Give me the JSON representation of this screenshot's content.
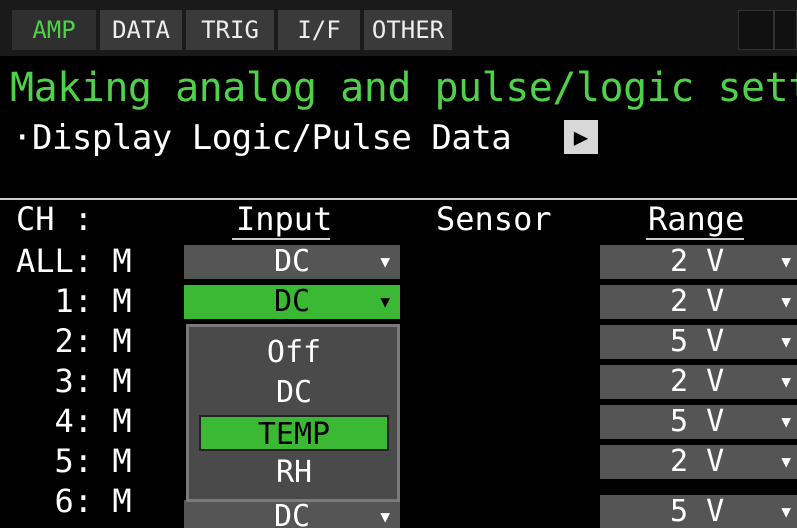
{
  "tabs": [
    {
      "label": "AMP",
      "active": true
    },
    {
      "label": "DATA",
      "active": false
    },
    {
      "label": "TRIG",
      "active": false
    },
    {
      "label": "I/F",
      "active": false
    },
    {
      "label": "OTHER",
      "active": false
    }
  ],
  "title": "Making analog and pulse/logic settings",
  "subtitle": "·Display Logic/Pulse Data",
  "play_icon": "play-icon",
  "headers": {
    "ch": "CH :",
    "input": "Input",
    "sensor": "Sensor",
    "range": "Range"
  },
  "rows": [
    {
      "ch": "ALL: M",
      "input": "DC",
      "range": "2 V"
    },
    {
      "ch": "  1: M",
      "input": "DC",
      "range": "2 V",
      "selected": true
    },
    {
      "ch": "  2: M",
      "range": "5 V"
    },
    {
      "ch": "  3: M",
      "range": "2 V"
    },
    {
      "ch": "  4: M",
      "range": "5 V"
    },
    {
      "ch": "  5: M",
      "range": "2 V"
    },
    {
      "ch": "  6: M",
      "input": "DC",
      "range": "5 V"
    }
  ],
  "dropdown": {
    "options": [
      "Off",
      "DC",
      "TEMP",
      "RH"
    ],
    "selected": "TEMP"
  },
  "colors": {
    "accent_green": "#3cb934",
    "title_green": "#4fd24a",
    "cell_gray": "#555555"
  }
}
